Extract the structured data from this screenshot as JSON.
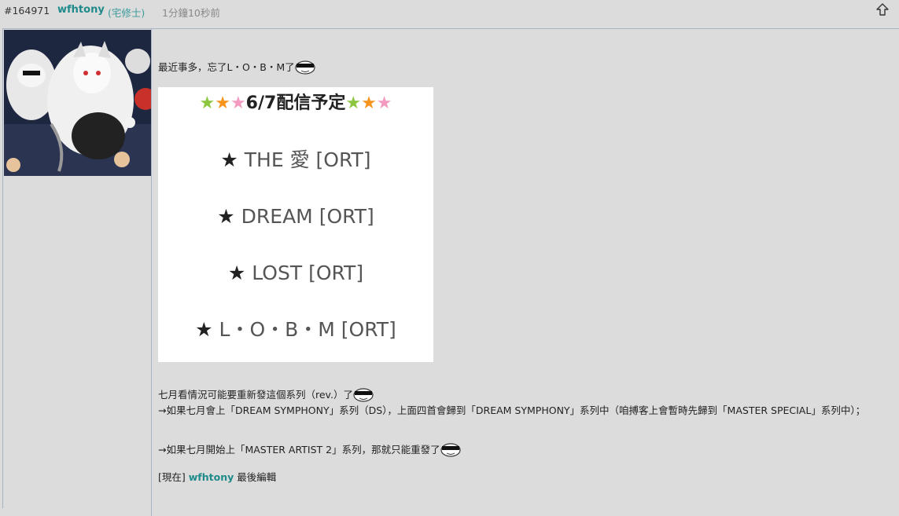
{
  "header": {
    "post_id": "#164971",
    "username": "wfhtony",
    "user_rank": "(宅修士)",
    "time_ago": "1分鐘10秒前",
    "up_icon": "arrow-up-outline-icon"
  },
  "post": {
    "line1": "最近事多，忘了L・O・B・M了",
    "image": {
      "title": "6/7配信予定",
      "title_star_colors": [
        "#8cc63f",
        "#f7941d",
        "#f49ac1"
      ],
      "items": [
        "THE 愛 [ORT]",
        "DREAM [ORT]",
        "LOST [ORT]",
        "L・O・B・M [ORT]"
      ]
    },
    "para1": "七月看情況可能要重新發這個系列（rev.）了",
    "para2": "→如果七月會上「DREAM SYMPHONY」系列（DS），上面四首會歸到「DREAM SYMPHONY」系列中（咱搏客上會暫時先歸到「MASTER SPECIAL」系列中）；",
    "para3": "→如果七月開始上「MASTER ARTIST 2」系列，那就只能重發了",
    "edit_prefix": "[現在]",
    "edit_user": "wfhtony",
    "edit_suffix": "最後編輯"
  },
  "colors": {
    "background": "#dcdcdc",
    "username": "#1f8a8a",
    "border": "#a8b4c4"
  }
}
